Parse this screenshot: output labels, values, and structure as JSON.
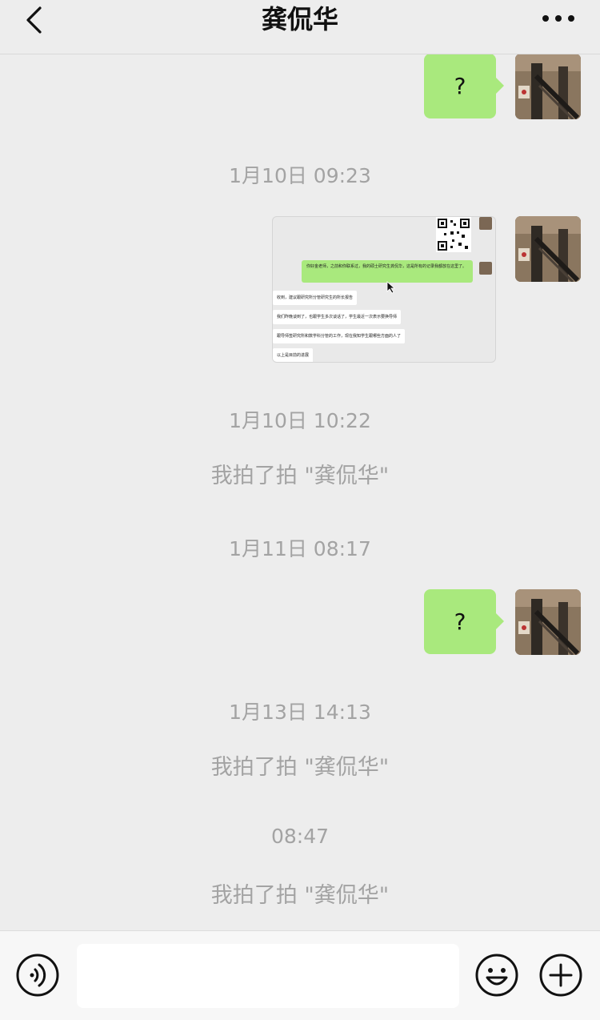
{
  "header": {
    "title": "龚侃华"
  },
  "chat": {
    "messages": [
      {
        "type": "outgoing_text",
        "text": "?"
      },
      {
        "type": "timestamp",
        "text": "1月10日 09:23"
      },
      {
        "type": "outgoing_image",
        "image_text": {
          "green_line": "你好金老师，之前和你联系过，我的硕士研究生龚侃华，这是所有的记录我都放在这里了。",
          "white_lines": [
            "收到，建议跟研究所分管研究生的所长报告",
            "我们昨晚谈到了，也跟学生多次谈话了，学生最近一次表示要换导师",
            "跟导师签研究所和数学科分管的工作，现在我知学生跟哪些方面的人了",
            "以上是目前的进展"
          ]
        }
      },
      {
        "type": "timestamp",
        "text": "1月10日 10:22"
      },
      {
        "type": "system",
        "text": "我拍了拍 \"龚侃华\""
      },
      {
        "type": "timestamp",
        "text": "1月11日 08:17"
      },
      {
        "type": "outgoing_text",
        "text": "?"
      },
      {
        "type": "timestamp",
        "text": "1月13日 14:13"
      },
      {
        "type": "system",
        "text": "我拍了拍 \"龚侃华\""
      },
      {
        "type": "timestamp",
        "text": "08:47"
      },
      {
        "type": "system",
        "text": "我拍了拍 \"龚侃华\""
      }
    ]
  },
  "input": {
    "value": ""
  },
  "colors": {
    "background": "#ededed",
    "header_bg": "#ededed",
    "bubble_green": "#a9e97d",
    "timestamp_gray": "#a3a3a3",
    "bottom_bar_bg": "#f7f7f7"
  },
  "icons": {
    "back": "chevron-left-icon",
    "more": "more-dots-icon",
    "voice": "voice-icon",
    "emoji": "emoji-icon",
    "plus": "plus-icon"
  }
}
